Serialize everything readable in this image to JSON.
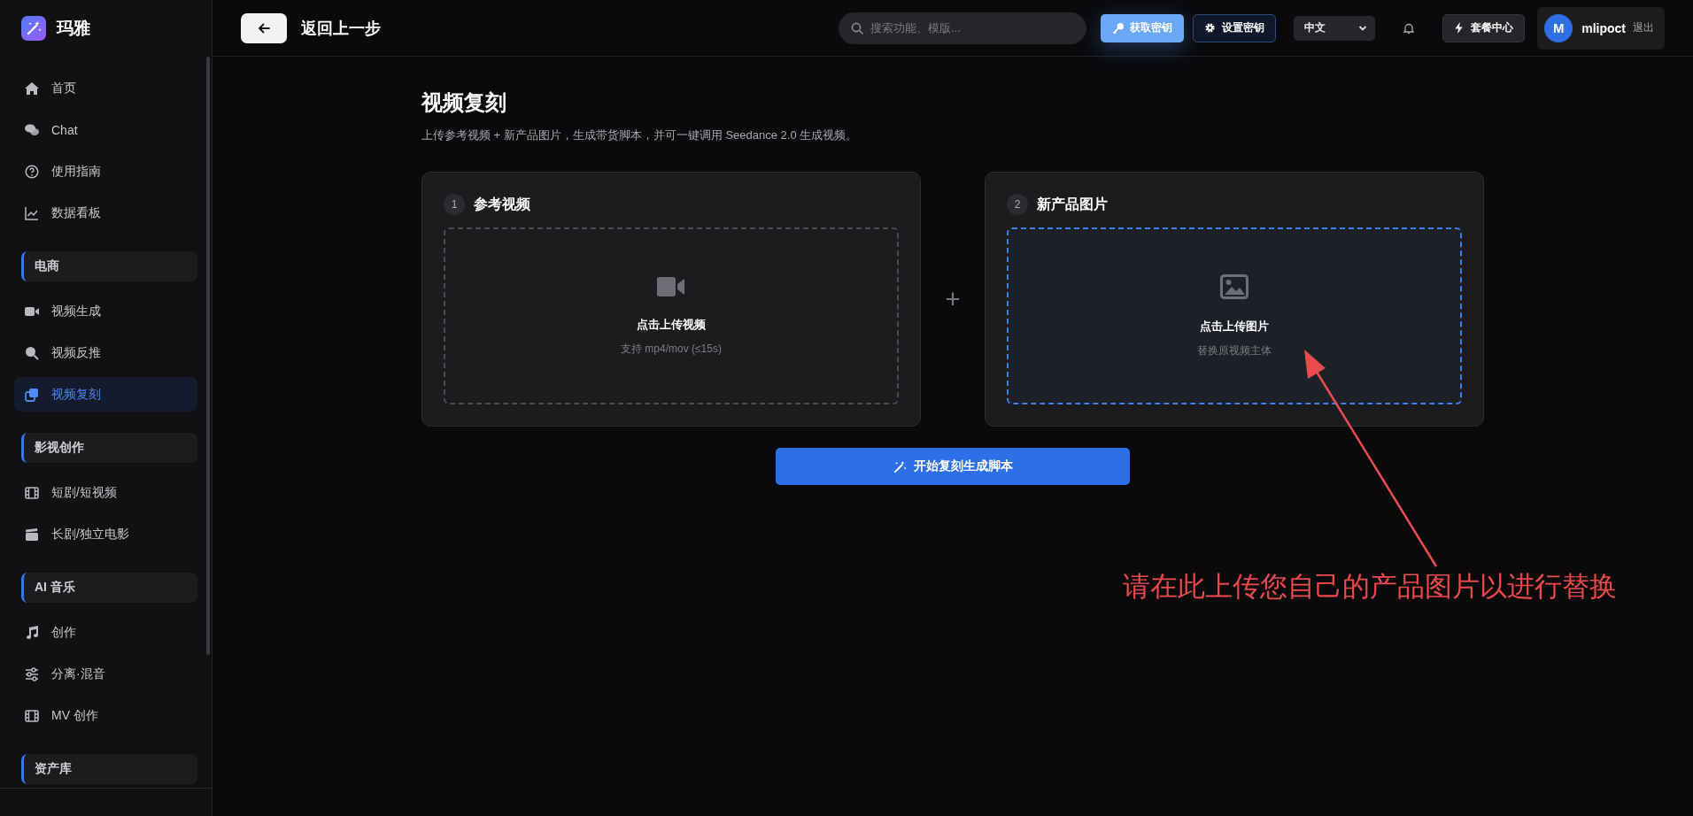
{
  "app": {
    "name": "玛雅"
  },
  "sidebar": {
    "items": [
      {
        "label": "首页",
        "selected": false
      },
      {
        "label": "Chat",
        "selected": false
      },
      {
        "label": "使用指南",
        "selected": false
      },
      {
        "label": "数据看板",
        "selected": false
      }
    ],
    "sections": [
      {
        "title": "电商",
        "items": [
          {
            "label": "视频生成",
            "selected": false
          },
          {
            "label": "视频反推",
            "selected": false
          },
          {
            "label": "视频复刻",
            "selected": true
          }
        ]
      },
      {
        "title": "影视创作",
        "items": [
          {
            "label": "短剧/短视频",
            "selected": false
          },
          {
            "label": "长剧/独立电影",
            "selected": false
          }
        ]
      },
      {
        "title": "AI 音乐",
        "items": [
          {
            "label": "创作",
            "selected": false
          },
          {
            "label": "分离·混音",
            "selected": false
          },
          {
            "label": "MV 创作",
            "selected": false
          }
        ]
      },
      {
        "title": "资产库"
      }
    ]
  },
  "topbar": {
    "back_label": "返回上一步",
    "search": {
      "placeholder": "搜索功能、模版..."
    },
    "buttons": [
      {
        "label": "获取密钥",
        "kind": "primary"
      },
      {
        "label": "设置密钥",
        "kind": "outline"
      }
    ],
    "language": "中文",
    "plan_button": "套餐中心",
    "user": {
      "initial": "M",
      "name": "mlipoct",
      "logout": "退出"
    }
  },
  "page": {
    "title": "视频复刻",
    "subtitle": "上传参考视频 + 新产品图片，生成带货脚本，并可一键调用 Seedance 2.0 生成视频。",
    "steps": [
      {
        "number": "1",
        "title": "参考视频",
        "upload_label": "点击上传视频",
        "hint": "支持 mp4/mov (≤15s)",
        "kind": "video",
        "active": false
      },
      {
        "number": "2",
        "title": "新产品图片",
        "upload_label": "点击上传图片",
        "hint": "替换原视频主体",
        "kind": "image",
        "active": true
      }
    ],
    "joiner": "+",
    "submit": "开始复刻生成脚本"
  },
  "annotation": {
    "text": "请在此上传您自己的产品图片以进行替换"
  }
}
